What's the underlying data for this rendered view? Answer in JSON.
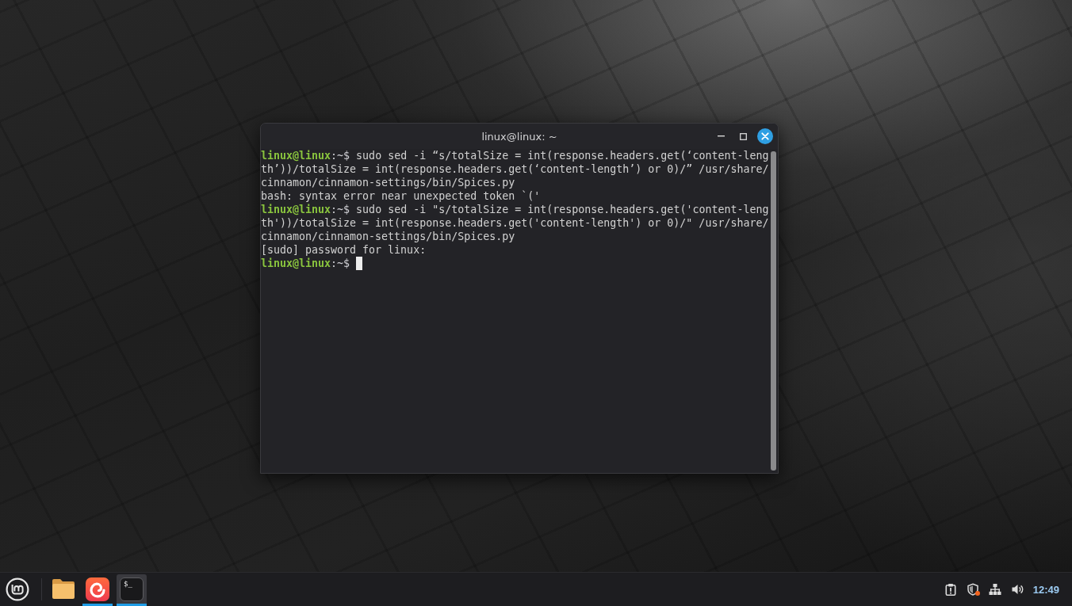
{
  "window": {
    "title": "linux@linux: ~",
    "lines": [
      {
        "kind": "command",
        "user_host": "linux@linux",
        "prompt_tail": ":~$",
        "command": "sudo sed -i “s/totalSize = int(response.headers.get(‘content-length’))/totalSize = int(response.headers.get(‘content-length’) or 0)/” /usr/share/cinnamon/cinnamon-settings/bin/Spices.py",
        "cursor": false
      },
      {
        "kind": "output",
        "text": "bash: syntax error near unexpected token `('",
        "cursor": false
      },
      {
        "kind": "command",
        "user_host": "linux@linux",
        "prompt_tail": ":~$",
        "command": "sudo sed -i \"s/totalSize = int(response.headers.get('content-length'))/totalSize = int(response.headers.get('content-length') or 0)/\" /usr/share/cinnamon/cinnamon-settings/bin/Spices.py",
        "cursor": false
      },
      {
        "kind": "output",
        "text": "[sudo] password for linux:",
        "cursor": false
      },
      {
        "kind": "command",
        "user_host": "linux@linux",
        "prompt_tail": ":~$",
        "cursor": true
      }
    ]
  },
  "taskbar": {
    "launchers": [
      {
        "kind": "folder",
        "running": false,
        "selected": false
      },
      {
        "kind": "swirl",
        "running": true,
        "selected": false
      },
      {
        "kind": "terminal",
        "glyph": "$_",
        "running": true,
        "selected": true
      }
    ],
    "tray": [
      {
        "kind": "updates",
        "badge": false
      },
      {
        "kind": "shield",
        "badge": true
      },
      {
        "kind": "network",
        "badge": false
      },
      {
        "kind": "volume",
        "badge": false
      }
    ],
    "clock": "12:49"
  }
}
